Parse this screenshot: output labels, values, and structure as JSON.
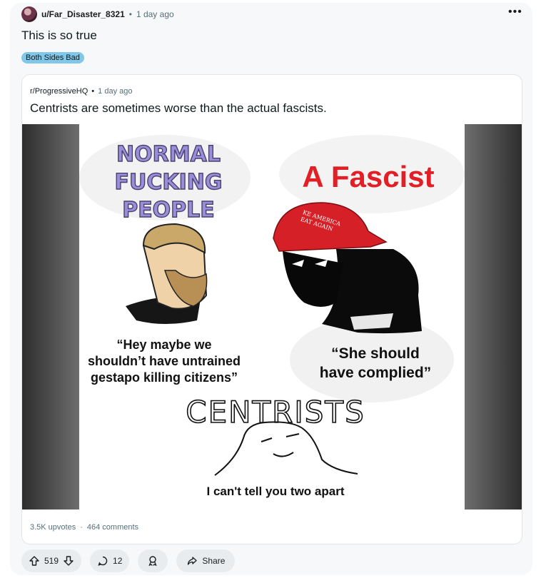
{
  "post": {
    "author": "u/Far_Disaster_8321",
    "separator": "•",
    "time": "1 day ago",
    "more_label": "•••",
    "title": "This is so true",
    "flair": "Both Sides Bad"
  },
  "crosspost": {
    "subreddit": "r/ProgressiveHQ",
    "separator": "•",
    "time": "1 day ago",
    "title": "Centrists are sometimes worse than the actual fascists.",
    "upvotes": "3.5K upvotes",
    "foot_separator": "·",
    "comments": "464 comments"
  },
  "meme": {
    "left_heading": [
      "NORMAL",
      "FUCKING",
      "PEOPLE"
    ],
    "right_heading": "A Fascist",
    "hat_text": [
      "KE AMERICA",
      "EAT AGAIN"
    ],
    "left_quote": [
      "“Hey maybe we",
      "shouldn’t have untrained",
      "gestapo killing citizens”"
    ],
    "right_quote": [
      "“She should",
      "have complied”"
    ],
    "bottom_heading": "CENTRISTS",
    "bottom_caption": "I can't tell you two apart"
  },
  "actions": {
    "votes": "519",
    "comments": "12",
    "share": "Share"
  },
  "colors": {
    "flair_bg": "#80c7e8",
    "heading_purple": "#9b8ed8",
    "fascist_red": "#e21f26",
    "action_bg": "#e9ecee"
  }
}
